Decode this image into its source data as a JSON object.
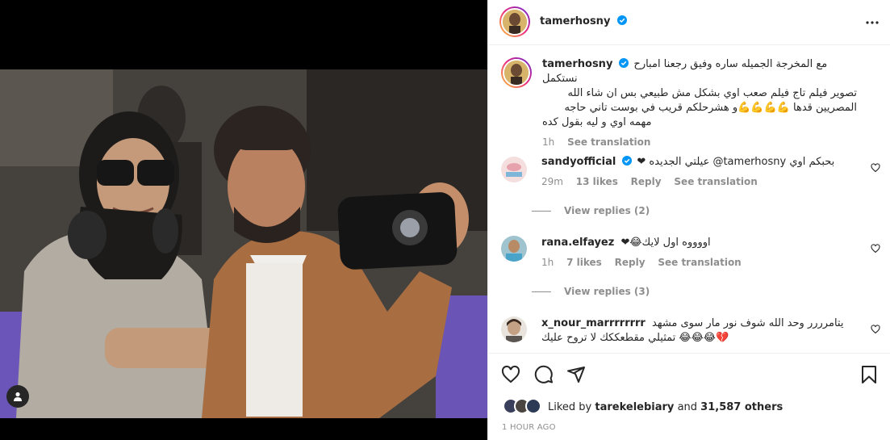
{
  "post": {
    "author": "tamerhosny",
    "more_icon": "more-horizontal-icon"
  },
  "caption": {
    "username": "tamerhosny",
    "line1": "مع المخرجة الجميله ساره وفيق رجعنا امبارح نستكمل",
    "line2": "تصوير فيلم تاج فيلم صعب اوي بشكل مش طبيعي بس ان شاء الله",
    "line3": "المصريين قدها 💪💪💪💪و هشرحلكم قريب في بوست تاني حاجه",
    "line4": "مهمه اوي و ليه بقول كده",
    "time": "1h",
    "see_translation": "See translation"
  },
  "comments": [
    {
      "username": "sandyofficial",
      "text": "❤ عيلتي الجديده @tamerhosny بحبكم اوي",
      "time": "29m",
      "likes": "13 likes",
      "reply": "Reply",
      "see_translation": "See translation",
      "view_replies": "View replies (2)"
    },
    {
      "username": "rana.elfayez",
      "text": "❤😂اووووه اول لايك",
      "time": "1h",
      "likes": "7 likes",
      "reply": "Reply",
      "see_translation": "See translation",
      "view_replies": "View replies (3)"
    },
    {
      "username": "x_nour_marrrrrrrr",
      "text_line1": "يتامرررر وحد الله شوف نور مار سوى مشهد",
      "text_line2": "💔😂😂😂 تمثيلي مقطعككك لا تروح عليك"
    }
  ],
  "likes": {
    "prefix": "Liked by",
    "user": "tarekelebiary",
    "and": "and",
    "others": "31,587 others"
  },
  "timestamp": "1 HOUR AGO",
  "colors": {
    "accent_blue": "#0095f6",
    "verified_blue": "#0095f6",
    "heart_red": "#ed4956",
    "muted": "#8e8e8e"
  }
}
